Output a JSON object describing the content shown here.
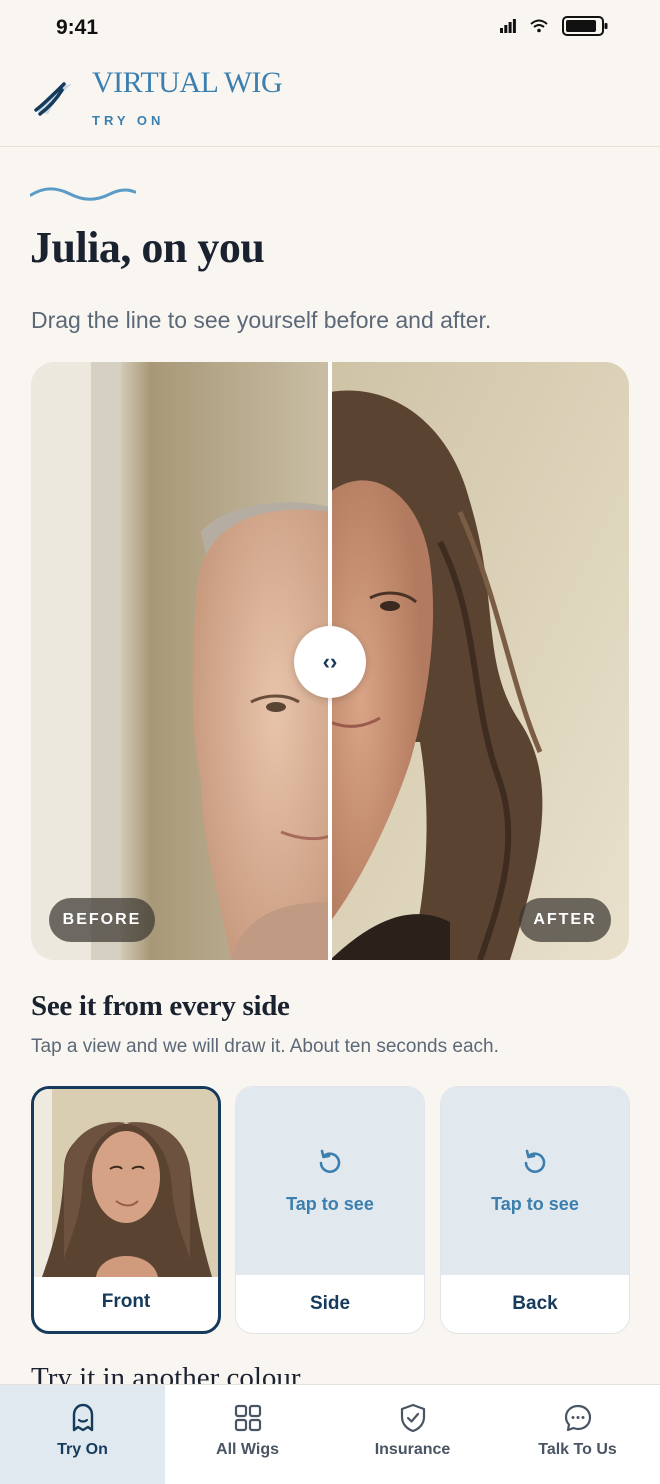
{
  "status": {
    "time": "9:41"
  },
  "header": {
    "brand": "VIRTUAL WIG",
    "subtitle": "TRY ON"
  },
  "page": {
    "title": "Julia, on you",
    "subtitle": "Drag the line to see yourself before and after."
  },
  "compare": {
    "before_label": "BEFORE",
    "after_label": "AFTER",
    "handle_glyph": "‹›",
    "split_position": 0.5
  },
  "views": {
    "title": "See it from every side",
    "subtitle": "Tap a view and we will draw it. About ten seconds each.",
    "items": [
      {
        "label": "Front",
        "state": "selected"
      },
      {
        "label": "Side",
        "placeholder": "Tap to see"
      },
      {
        "label": "Back",
        "placeholder": "Tap to see"
      }
    ]
  },
  "next_section_peek": "Try it in another colour",
  "tabs": [
    {
      "label": "Try On",
      "icon": "ghost-icon",
      "active": true
    },
    {
      "label": "All Wigs",
      "icon": "grid-icon"
    },
    {
      "label": "Insurance",
      "icon": "shield-check-icon"
    },
    {
      "label": "Talk To Us",
      "icon": "chat-bubble-icon"
    }
  ],
  "colors": {
    "brand": "#3c7fae",
    "navy": "#163a5c",
    "background": "#f9f6f2"
  }
}
